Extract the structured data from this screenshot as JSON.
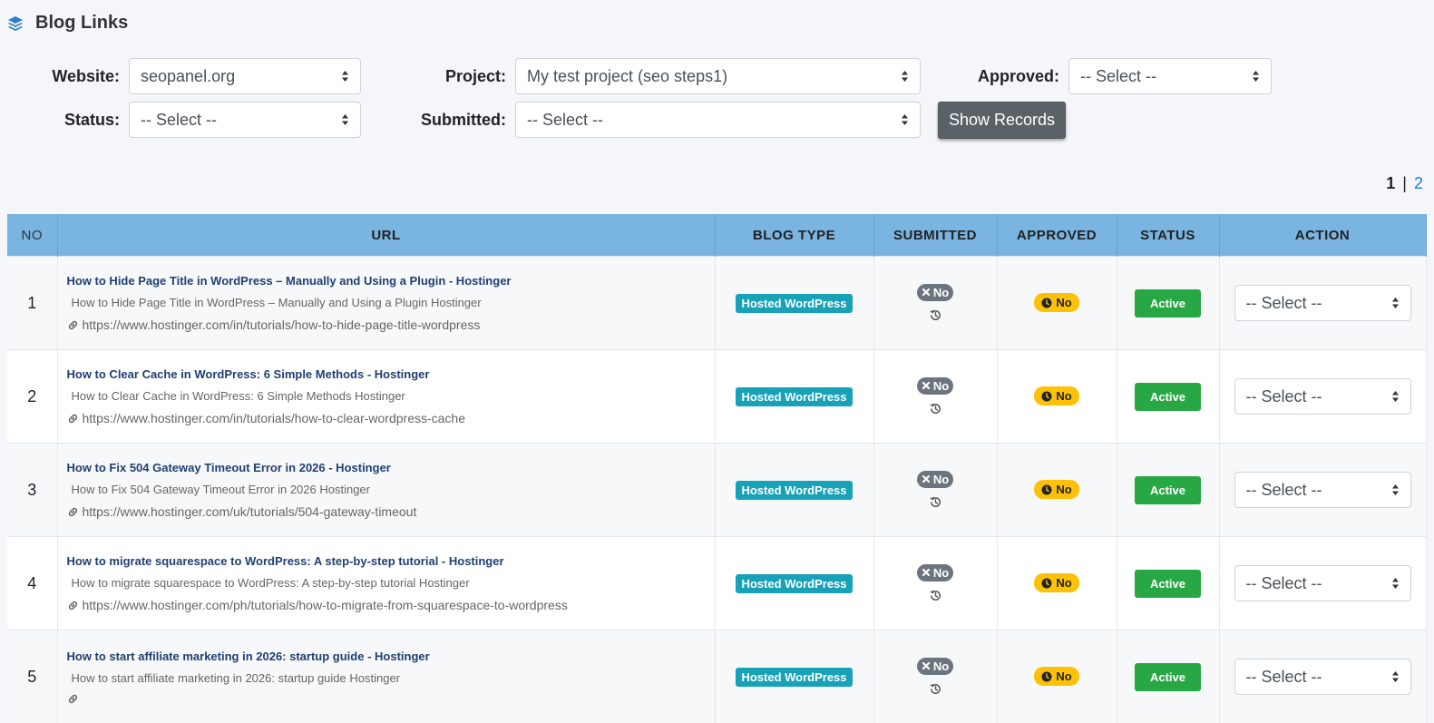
{
  "page": {
    "title": "Blog Links",
    "title_icon": "layers-icon"
  },
  "filters": {
    "website_label": "Website:",
    "website_value": "seopanel.org",
    "project_label": "Project:",
    "project_value": "My test project (seo steps1)",
    "approved_label": "Approved:",
    "approved_value": "-- Select --",
    "status_label": "Status:",
    "status_value": "-- Select --",
    "submitted_label": "Submitted:",
    "submitted_value": "-- Select --",
    "show_button": "Show Records"
  },
  "pagination": {
    "current": "1",
    "separator": "|",
    "next": "2"
  },
  "table": {
    "headers": {
      "no": "NO",
      "url": "URL",
      "blog_type": "BLOG TYPE",
      "submitted": "SUBMITTED",
      "approved": "APPROVED",
      "status": "STATUS",
      "action": "ACTION"
    },
    "rows": [
      {
        "no": "1",
        "title": "How to Hide Page Title in WordPress – Manually and Using a Plugin - Hostinger",
        "desc": "How to Hide Page Title in WordPress – Manually and Using a Plugin  Hostinger",
        "url": "https://www.hostinger.com/in/tutorials/how-to-hide-page-title-wordpress",
        "blog_type": "Hosted WordPress",
        "submitted": "No",
        "approved": "No",
        "status": "Active",
        "action": "-- Select --"
      },
      {
        "no": "2",
        "title": "How to Clear Cache in WordPress: 6 Simple Methods - Hostinger",
        "desc": "How to Clear Cache in WordPress: 6 Simple Methods  Hostinger",
        "url": "https://www.hostinger.com/in/tutorials/how-to-clear-wordpress-cache",
        "blog_type": "Hosted WordPress",
        "submitted": "No",
        "approved": "No",
        "status": "Active",
        "action": "-- Select --"
      },
      {
        "no": "3",
        "title": "How to Fix 504 Gateway Timeout Error in 2026 - Hostinger",
        "desc": "How to Fix 504 Gateway Timeout Error in 2026  Hostinger",
        "url": "https://www.hostinger.com/uk/tutorials/504-gateway-timeout",
        "blog_type": "Hosted WordPress",
        "submitted": "No",
        "approved": "No",
        "status": "Active",
        "action": "-- Select --"
      },
      {
        "no": "4",
        "title": "How to migrate squarespace to WordPress: A step-by-step tutorial - Hostinger",
        "desc": "How to migrate squarespace to WordPress: A step-by-step tutorial  Hostinger",
        "url": "https://www.hostinger.com/ph/tutorials/how-to-migrate-from-squarespace-to-wordpress",
        "blog_type": "Hosted WordPress",
        "submitted": "No",
        "approved": "No",
        "status": "Active",
        "action": "-- Select --"
      },
      {
        "no": "5",
        "title": "How to start affiliate marketing in 2026: startup guide - Hostinger",
        "desc": "How to start affiliate marketing in 2026: startup guide  Hostinger",
        "url": "",
        "blog_type": "Hosted WordPress",
        "submitted": "No",
        "approved": "No",
        "status": "Active",
        "action": "-- Select --"
      }
    ]
  },
  "colors": {
    "header_bg": "#7ab4e0",
    "link_title": "#1f3f73",
    "blog_type_badge": "#17a2b8",
    "submitted_badge": "#6c757d",
    "approved_badge": "#ffc107",
    "status_badge": "#28a745",
    "show_button": "#5a6268"
  }
}
